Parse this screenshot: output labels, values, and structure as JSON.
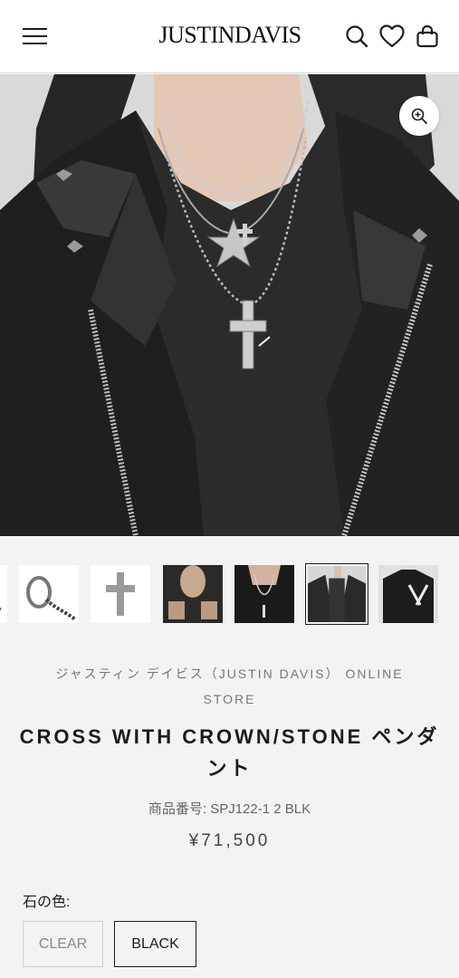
{
  "header": {
    "brand": "JUSTINDAVIS",
    "icons": [
      "menu-icon",
      "search-icon",
      "heart-icon",
      "bag-icon"
    ]
  },
  "gallery": {
    "thumbnails": [
      "chain-pendant",
      "chain-clasp",
      "cross-pendant",
      "model-hands",
      "model-necklace",
      "model-jacket",
      "model-dark"
    ],
    "active_index": 5
  },
  "product": {
    "vendor": "ジャスティン デイビス（JUSTIN DAVIS） ONLINE STORE",
    "title": "CROSS WITH CROWN/STONE ペンダント",
    "sku": "商品番号: SPJ122-1 2 BLK",
    "price": "¥71,500",
    "option_label": "石の色:",
    "options": [
      {
        "label": "CLEAR",
        "selected": false
      },
      {
        "label": "BLACK",
        "selected": true
      }
    ]
  },
  "colors": {
    "page_bg": "#f3f3f3",
    "text": "#1c1c1c",
    "muted": "#777777"
  }
}
